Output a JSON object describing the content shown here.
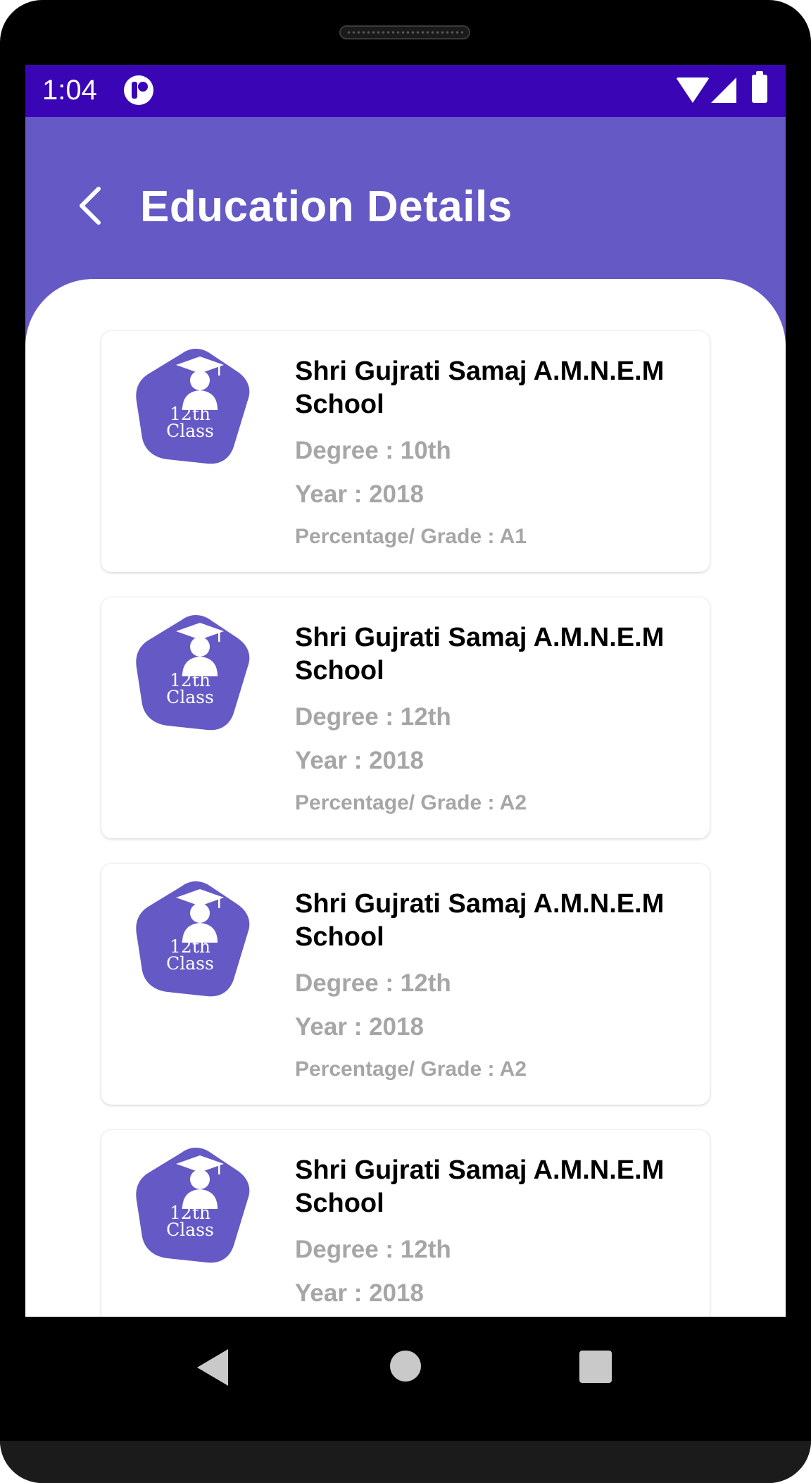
{
  "status_bar": {
    "time": "1:04",
    "icons": [
      "app-notification-icon",
      "wifi-icon",
      "signal-icon",
      "battery-icon"
    ]
  },
  "app_bar": {
    "title": "Education Details",
    "back_icon": "chevron-left-icon",
    "background_color": "#6559c6"
  },
  "colors": {
    "status_bar": "#3a06b5",
    "accent": "#6559c6",
    "secondary_text": "#a6a6a6"
  },
  "badge": {
    "line1": "12th",
    "line2": "Class",
    "icon": "graduate-icon"
  },
  "education": [
    {
      "school": "Shri Gujrati Samaj A.M.N.E.M School",
      "degree": "Degree : 10th",
      "year": "Year : 2018",
      "grade": "Percentage/ Grade : A1"
    },
    {
      "school": "Shri Gujrati Samaj A.M.N.E.M School",
      "degree": "Degree : 12th",
      "year": "Year : 2018",
      "grade": "Percentage/ Grade : A2"
    },
    {
      "school": "Shri Gujrati Samaj A.M.N.E.M School",
      "degree": "Degree : 12th",
      "year": "Year : 2018",
      "grade": "Percentage/ Grade : A2"
    },
    {
      "school": "Shri Gujrati Samaj A.M.N.E.M School",
      "degree": "Degree : 12th",
      "year": "Year : 2018",
      "grade": ""
    }
  ],
  "nav_bar": {
    "icons": [
      "nav-back-icon",
      "nav-home-icon",
      "nav-recents-icon"
    ]
  }
}
